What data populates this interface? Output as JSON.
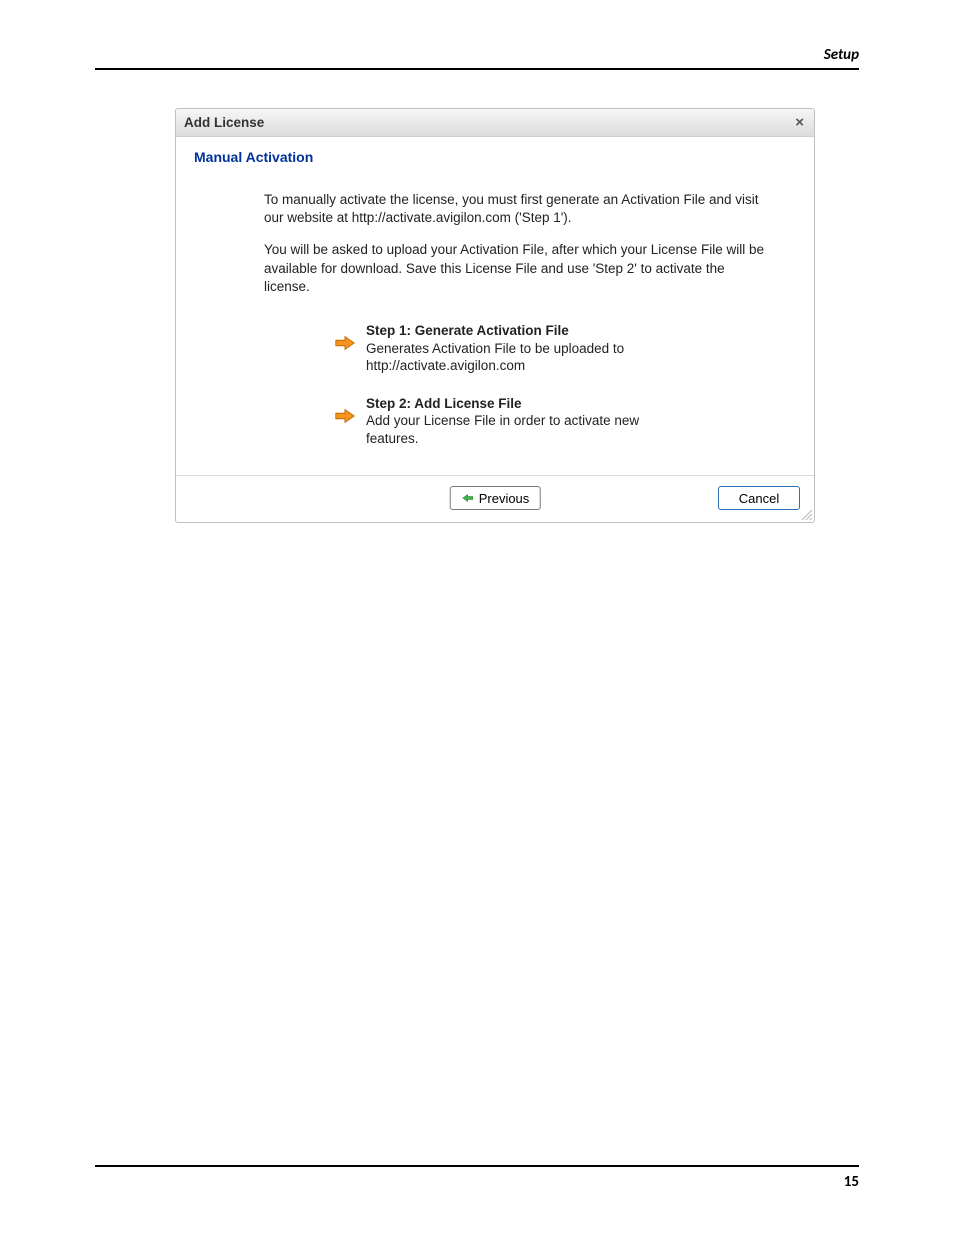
{
  "page": {
    "header": "Setup",
    "footer_page": "15"
  },
  "dialog": {
    "title": "Add License",
    "close_glyph": "×",
    "section_title": "Manual Activation",
    "paragraph1": "To manually activate the license, you must first generate an Activation File and visit our website at http://activate.avigilon.com ('Step 1').",
    "paragraph2": "You will be asked to upload your Activation File, after which your License File will be available for download. Save this License File and use 'Step 2' to activate the license.",
    "step1": {
      "title": "Step 1: Generate Activation File",
      "desc": "Generates Activation File to be uploaded to http://activate.avigilon.com"
    },
    "step2": {
      "title": "Step 2: Add License File",
      "desc": "Add your License File in order to activate new features."
    },
    "buttons": {
      "previous": "Previous",
      "cancel": "Cancel"
    }
  }
}
